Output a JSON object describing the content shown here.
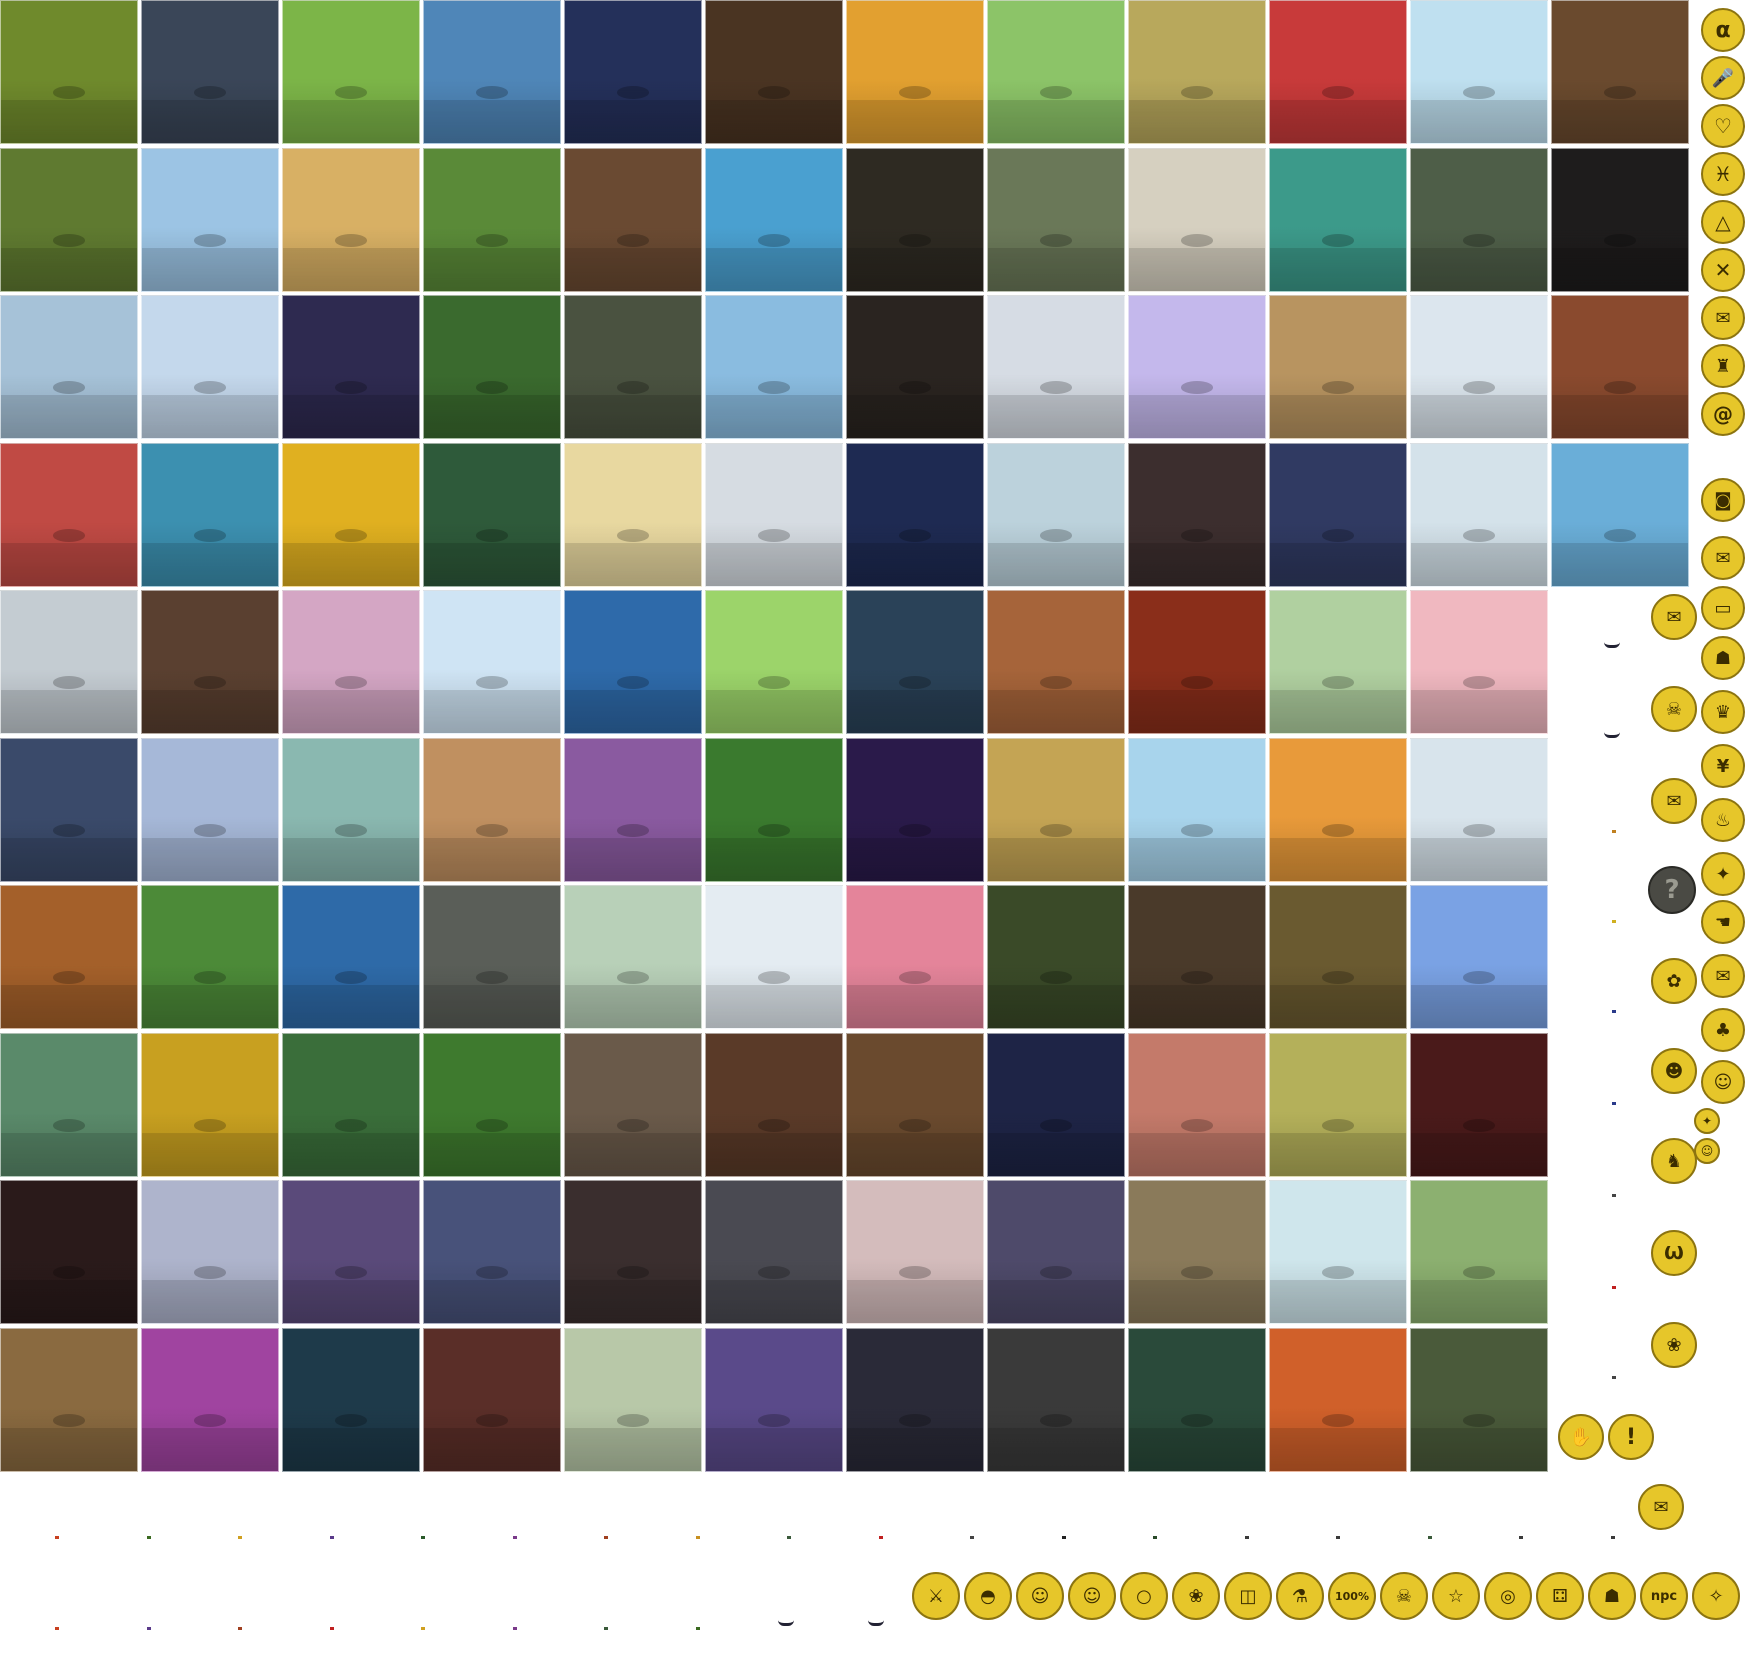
{
  "sheet": {
    "background": "#ffffff",
    "badge_color": "#e6c62a",
    "badge_border": "#8c7410"
  },
  "tiles": [
    [
      "#6f8a2c",
      "#3a4658",
      "#7cb548",
      "#4f86b8",
      "#24305a",
      "#4a3422",
      "#e2a030",
      "#8cc468",
      "#b8a85c",
      "#c83a3a",
      "#bfe0f0",
      "#6a4a2e"
    ],
    [
      "#5f7a30",
      "#9cc4e4",
      "#d8b064",
      "#5a8a38",
      "#6a4a32",
      "#4aa0d0",
      "#2e2a22",
      "#6a7858",
      "#d6d0c0",
      "#3c9a8a",
      "#4e5e48",
      "#1e1c1c"
    ],
    [
      "#a6c2d8",
      "#c4d8ec",
      "#2e2a50",
      "#3a6a2e",
      "#4a5240",
      "#8abce0",
      "#2a2420",
      "#d6dce4",
      "#c4b8ec",
      "#b89460",
      "#dce6ee",
      "#8a4a2e"
    ],
    [
      "#c04a44",
      "#3c90b0",
      "#e0b020",
      "#2e5a3a",
      "#e8d8a0",
      "#d6dce2",
      "#1e2a52",
      "#bcd2dc",
      "#3c2e2e",
      "#303a62",
      "#d4e2ea",
      "#6aaed8"
    ],
    [
      "#c4ccd2",
      "#5a4030",
      "#d4a6c4",
      "#cfe4f4",
      "#2e6aaa",
      "#9cd46a",
      "#2a4258",
      "#a6643a",
      "#8a2e1a",
      "#b0d0a0",
      "#f0b8c0"
    ],
    [
      "#3a4a6a",
      "#a6b8d8",
      "#8ab8b0",
      "#c09060",
      "#8a5aa0",
      "#3a7a2e",
      "#2a1a4a",
      "#c4a454",
      "#a8d4ec",
      "#e89a3a",
      "#d8e4ec"
    ],
    [
      "#a4602a",
      "#4c8a38",
      "#2e6aa8",
      "#5a5e58",
      "#b8d0b8",
      "#e4ecf2",
      "#e4849a",
      "#3a4a28",
      "#4a3a2a",
      "#6a5a30",
      "#7aa2e4"
    ],
    [
      "#5a8a6a",
      "#c8a020",
      "#3a6e3a",
      "#3e7a2e",
      "#6a5a4a",
      "#5a3a28",
      "#6a4a2e",
      "#1e2446",
      "#c47a6a",
      "#b4b05a",
      "#4a1a1a"
    ],
    [
      "#2a1a1a",
      "#aeb4cc",
      "#5a4a7a",
      "#48527a",
      "#3a2e2e",
      "#4a4a52",
      "#d4bcbc",
      "#4e4a6a",
      "#8a7a5a",
      "#cfe6ec",
      "#8cb070"
    ],
    [
      "#8a6a40",
      "#a044a0",
      "#1e3a4a",
      "#5a2e28",
      "#b8c8a8",
      "#5a4a8a",
      "#2a2a38",
      "#3a3a3a",
      "#2a4a3a",
      "#d0602a",
      "#4a5a3a"
    ]
  ],
  "badges_right": [
    "α",
    "",
    ""
  ],
  "badge_npc": "npc",
  "badge_percent": "100%",
  "badge_question": "?",
  "badge_exclaim": "!"
}
